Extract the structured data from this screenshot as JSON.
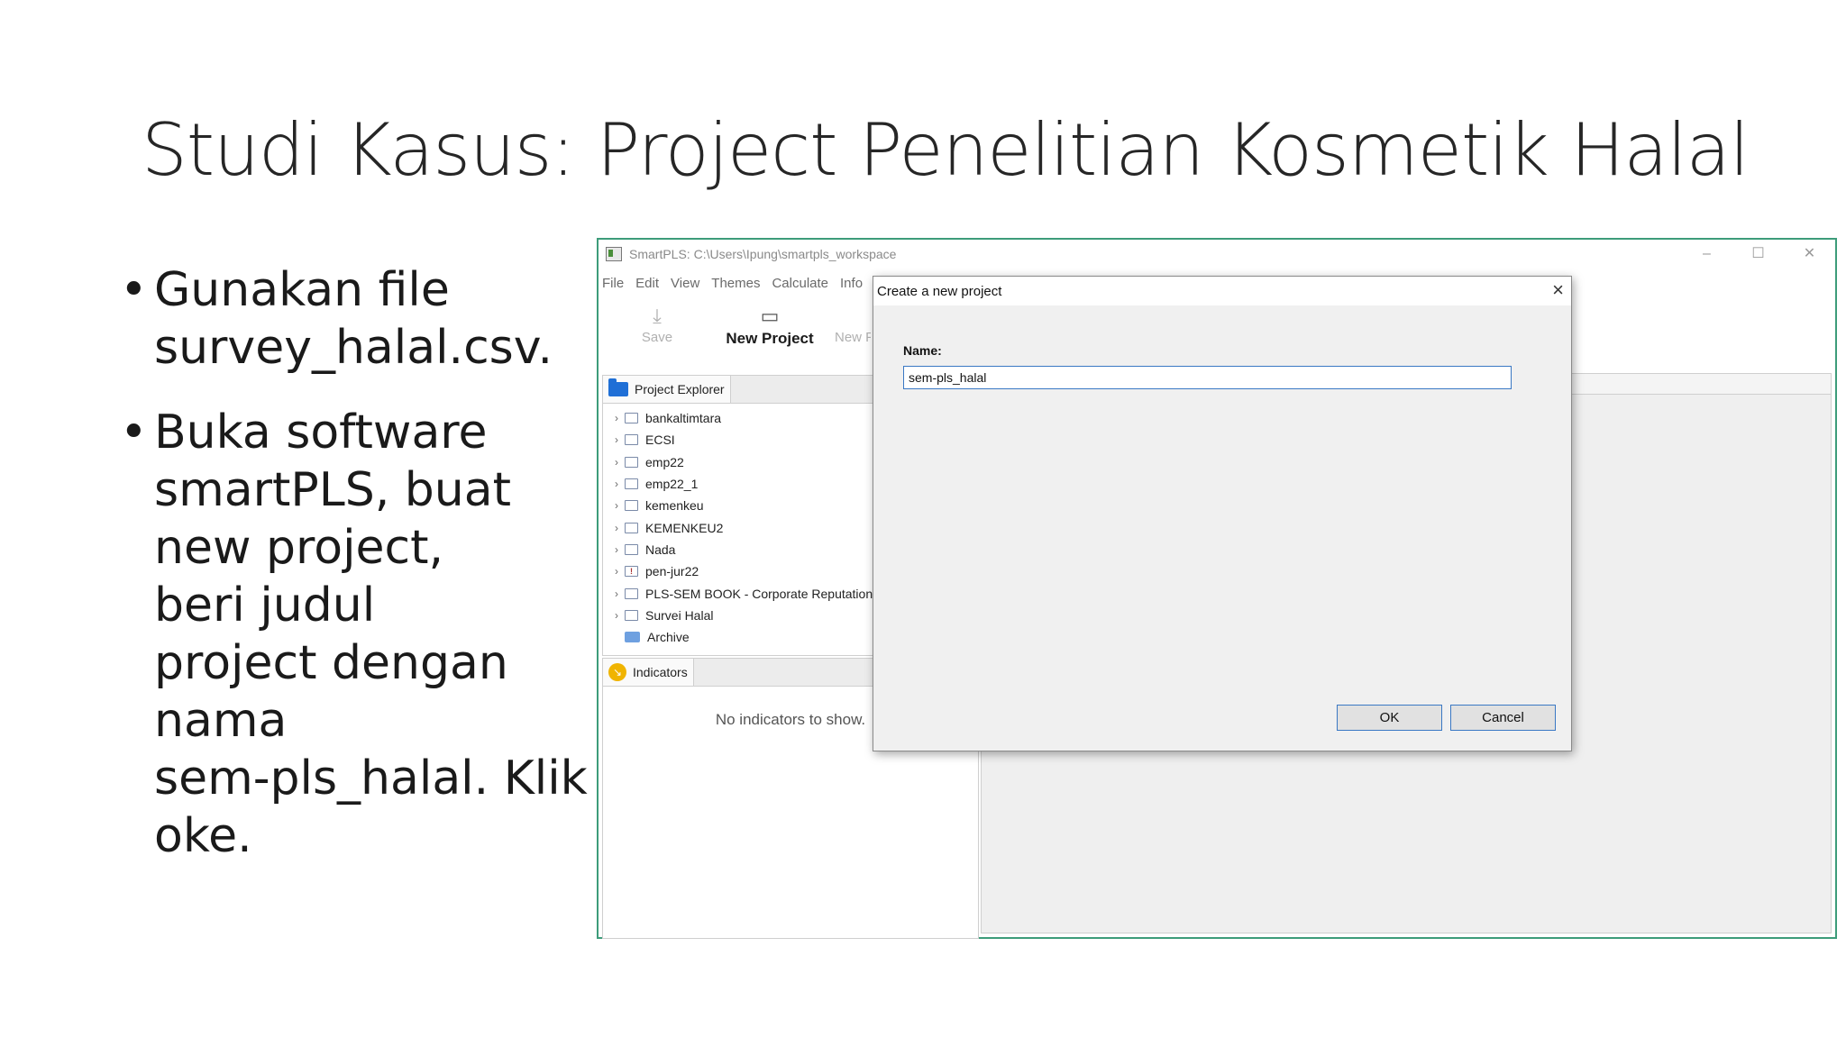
{
  "slide": {
    "title": "Studi Kasus: Project Penelitian Kosmetik Halal",
    "bullets": [
      "Gunakan file\nsurvey_halal.csv.",
      "Buka software\nsmartPLS, buat\nnew project,\nberi judul\nproject dengan\nnama\nsem-pls_halal. Klik\noke."
    ]
  },
  "app": {
    "window_title": "SmartPLS: C:\\Users\\Ipung\\smartpls_workspace",
    "window_controls": [
      "–",
      "☐",
      "✕"
    ],
    "menu": [
      "File",
      "Edit",
      "View",
      "Themes",
      "Calculate",
      "Info"
    ],
    "toolbar": {
      "save_label": "Save",
      "new_project_label": "New Project",
      "new_partial_label": "New F"
    },
    "project_explorer": {
      "tab_label": "Project Explorer",
      "items": [
        {
          "label": "bankaltimtara",
          "icon": "project-icon"
        },
        {
          "label": "ECSI",
          "icon": "project-icon"
        },
        {
          "label": "emp22",
          "icon": "project-icon"
        },
        {
          "label": "emp22_1",
          "icon": "project-icon"
        },
        {
          "label": "kemenkeu",
          "icon": "project-icon"
        },
        {
          "label": "KEMENKEU2",
          "icon": "project-icon"
        },
        {
          "label": "Nada",
          "icon": "project-icon"
        },
        {
          "label": "pen-jur22",
          "icon": "project-warning-icon"
        },
        {
          "label": "PLS-SEM BOOK - Corporate Reputation",
          "icon": "project-icon"
        },
        {
          "label": "Survei Halal",
          "icon": "project-icon"
        },
        {
          "label": "Archive",
          "icon": "archive-icon"
        }
      ]
    },
    "indicators": {
      "tab_label": "Indicators",
      "empty_message": "No indicators to show."
    }
  },
  "dialog": {
    "title": "Create a new project",
    "name_label": "Name:",
    "name_value": "sem-pls_halal",
    "ok_label": "OK",
    "cancel_label": "Cancel"
  },
  "colors": {
    "window_border": "#3d9c7a",
    "focus_blue": "#3a78c4",
    "folder_blue": "#1f6fd6",
    "indicator_badge": "#f0b400"
  }
}
